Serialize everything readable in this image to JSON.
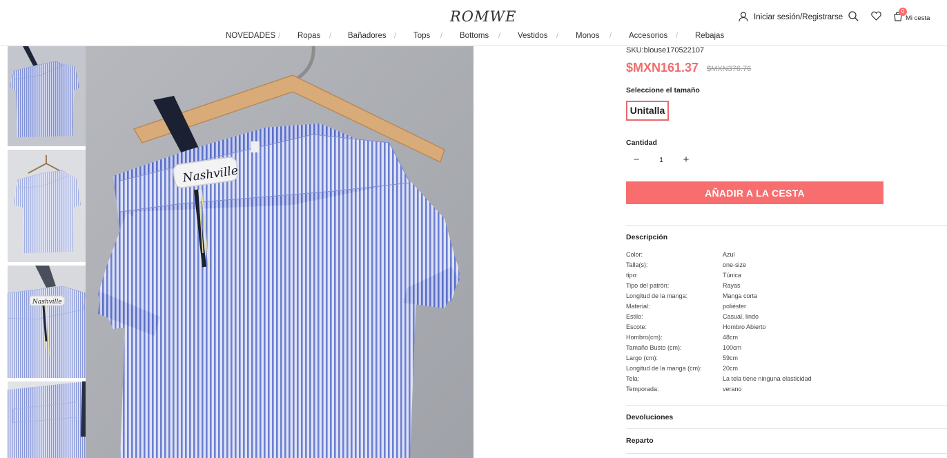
{
  "header": {
    "logo": "ROMWE",
    "login_label": "Iniciar sesión/Registrarse",
    "cart_label": "Mi cesta",
    "cart_count": "0"
  },
  "nav": {
    "items": [
      "NOVEDADES",
      "Ropas",
      "Bañadores",
      "Tops",
      "Bottoms",
      "Vestidos",
      "Monos",
      "Accesorios",
      "Rebajas"
    ],
    "separator": "/"
  },
  "gallery": {
    "patch_text": "Nashville"
  },
  "product": {
    "sku": "SKU:blouse170522107",
    "price": "$MXN161.37",
    "old_price": "$MXN376.76",
    "size_title": "Seleccione el tamaño",
    "size_option": "Unitalla",
    "qty_title": "Cantidad",
    "qty_minus": "−",
    "qty_value": "1",
    "qty_plus": "+",
    "add_to_cart": "AÑADIR A LA CESTA"
  },
  "description": {
    "title": "Descripción",
    "specs": [
      {
        "key": "Color:",
        "value": "Azul"
      },
      {
        "key": "Talla(s):",
        "value": "one-size"
      },
      {
        "key": "tipo:",
        "value": "Túnica"
      },
      {
        "key": "Tipo del patrón:",
        "value": "Rayas"
      },
      {
        "key": "Longitud de la manga:",
        "value": "Manga corta"
      },
      {
        "key": "Material:",
        "value": "poliéster"
      },
      {
        "key": "Estilo:",
        "value": "Casual, lindo"
      },
      {
        "key": "Escote:",
        "value": "Hombro Abierto"
      },
      {
        "key": "Hombro(cm):",
        "value": "48cm"
      },
      {
        "key": "Tamaño Busto (cm):",
        "value": "100cm"
      },
      {
        "key": "Largo (cm):",
        "value": "59cm"
      },
      {
        "key": "Longitud de la manga (cm):",
        "value": "20cm"
      },
      {
        "key": "Tela:",
        "value": "La tela tiene ninguna elasticidad"
      },
      {
        "key": "Temporada:",
        "value": "verano"
      }
    ]
  },
  "sections": {
    "returns": "Devoluciones",
    "shipping": "Reparto"
  },
  "colors": {
    "accent": "#f86e6e",
    "price": "#f26d6d"
  }
}
